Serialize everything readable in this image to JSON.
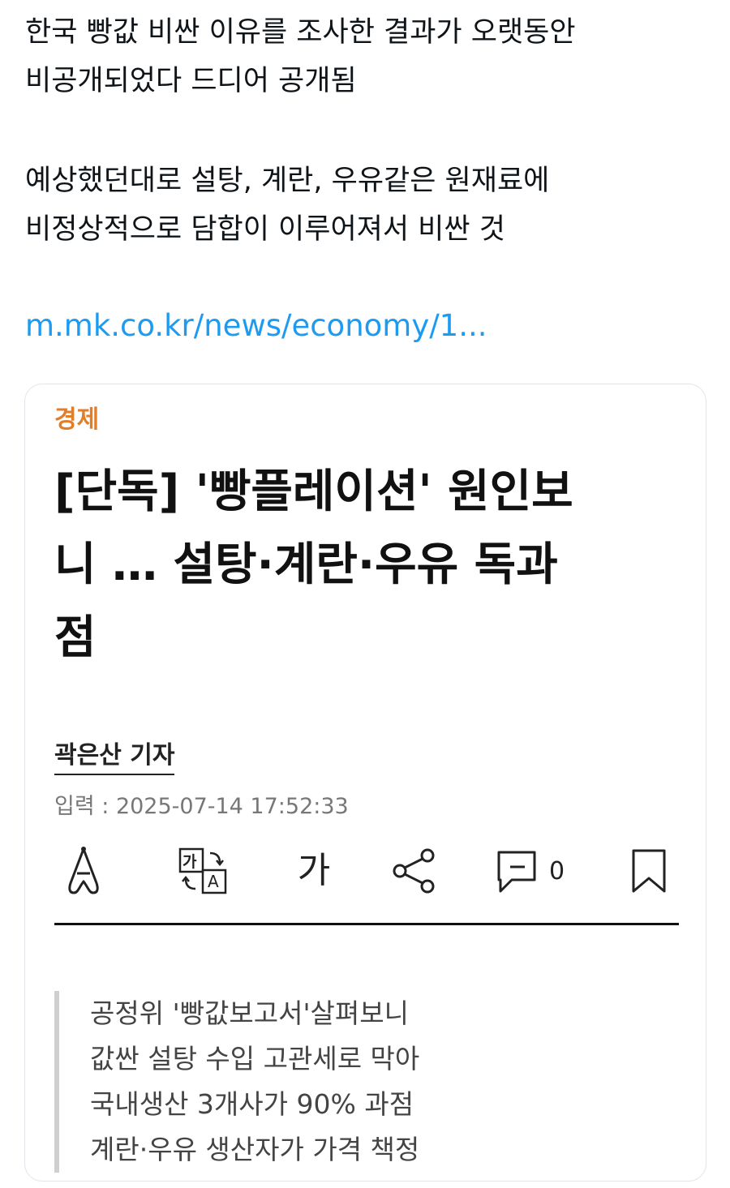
{
  "post": {
    "lines": [
      "한국 빵값 비싼 이유를 조사한 결과가 오랫동안",
      "비공개되었다 드디어 공개됨",
      "예상했던대로 설탕, 계란, 우유같은 원재료에",
      "비정상적으로 담합이 이루어져서 비싼 것"
    ],
    "link_text": "m.mk.co.kr/news/economy/1..."
  },
  "card": {
    "section": "경제",
    "headline_lines": [
      "[단독] '빵플레이션' 원인보",
      "니 … 설탕·계란·우유 독과",
      "점"
    ],
    "reporter": "곽은산 기자",
    "dateline": "입력 : 2025-07-14 17:52:33",
    "toolbar": {
      "font_size_glyph": "가",
      "translate_glyph_ko": "가",
      "translate_glyph_en": "A",
      "comment_count": "0"
    },
    "summary_lines": [
      "공정위 '빵값보고서'살펴보니",
      "값싼 설탕 수입 고관세로 막아",
      "국내생산 3개사가 90% 과점",
      "계란·우유 생산자가 가격 책정"
    ]
  },
  "icons": {
    "reader_mode": "reader-mode-icon",
    "translate": "translate-icon",
    "font_size": "font-size-icon",
    "share": "share-icon",
    "comment": "comment-icon",
    "bookmark": "bookmark-icon"
  },
  "colors": {
    "link": "#1d9bf0",
    "section_tag": "#e27d2a",
    "text": "#0f1419",
    "card_border": "#e1e5e9",
    "summary_bar": "#cfcfcf"
  }
}
